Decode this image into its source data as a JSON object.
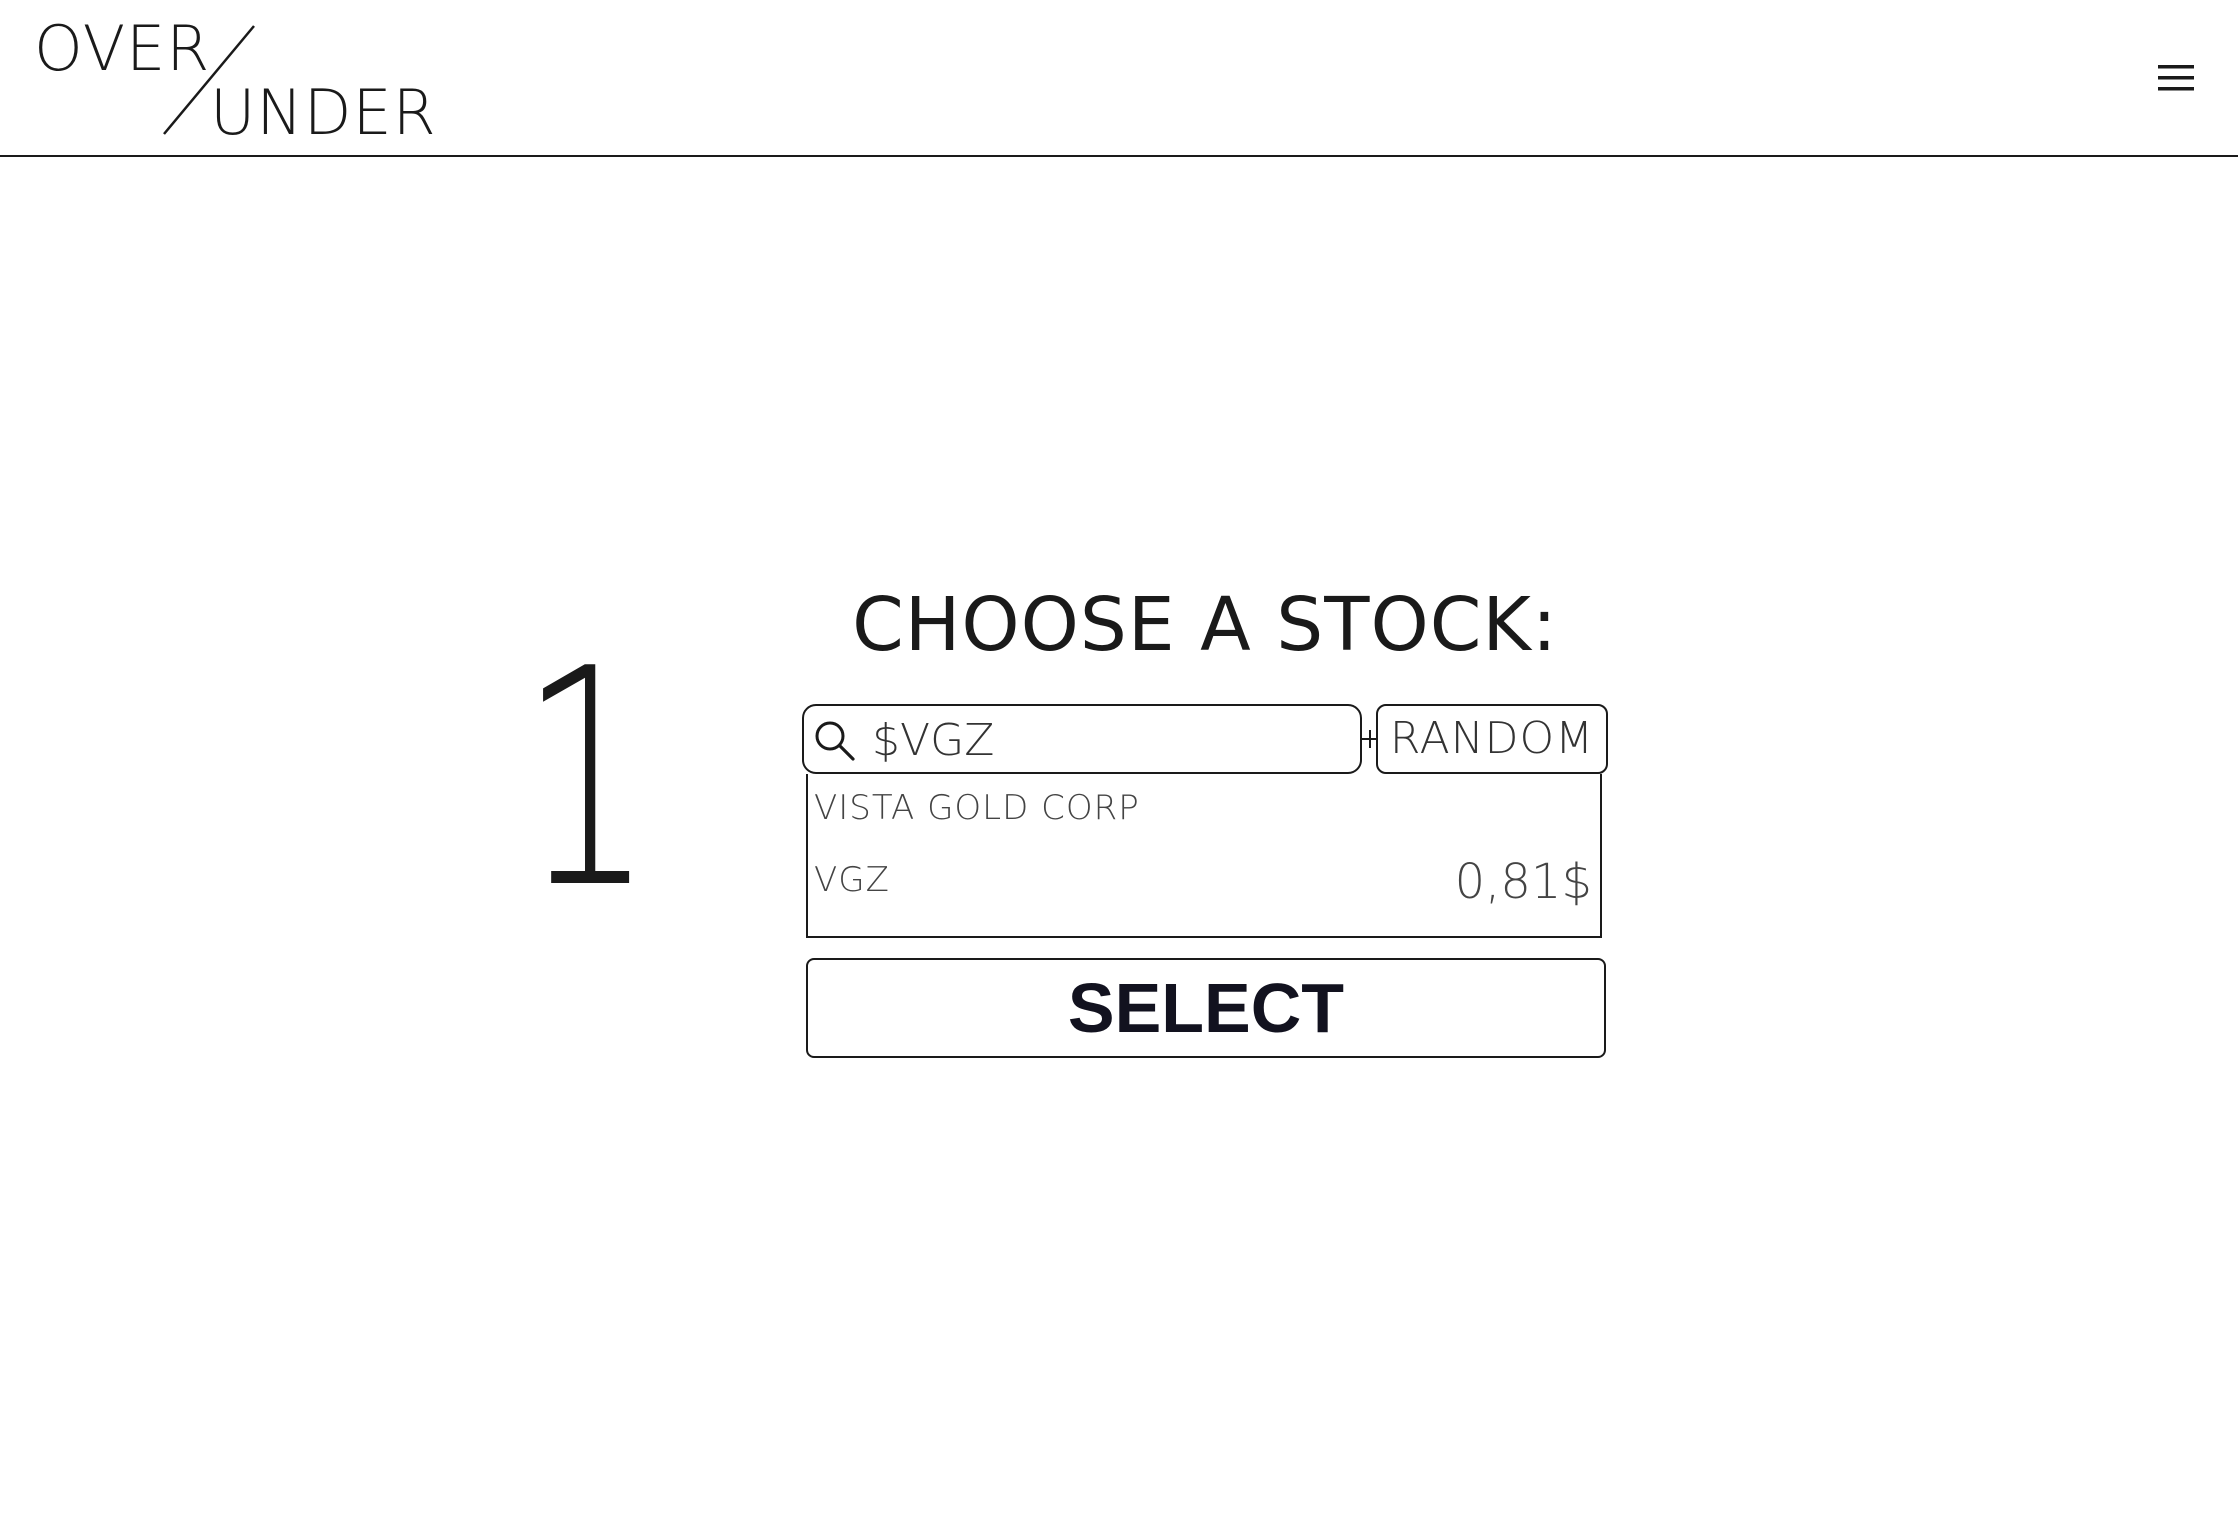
{
  "header": {
    "logo": {
      "top_word": "OVER",
      "bottom_word": "UNDER"
    },
    "menu_icon": "hamburger-menu-icon"
  },
  "step": {
    "number": "1"
  },
  "main": {
    "title": "CHOOSE A STOCK:",
    "search": {
      "value": "$VGZ",
      "icon": "search-icon"
    },
    "random_label": "RANDOM",
    "result": {
      "name": "VISTA GOLD CORP",
      "ticker": "VGZ",
      "price": "0,81$"
    },
    "select_label": "SELECT"
  },
  "colors": {
    "foreground": "#1a1a1a",
    "background": "#ffffff",
    "select_text": "#12121f"
  }
}
